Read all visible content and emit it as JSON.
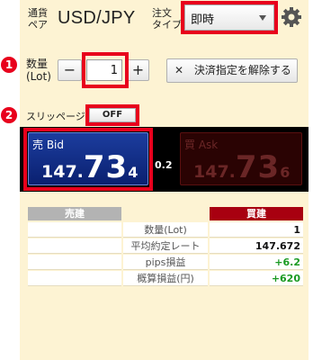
{
  "header": {
    "pair_label": "通貨\nペア",
    "pair_label_line1": "通貨",
    "pair_label_line2": "ペア",
    "pair_value": "USD/JPY",
    "order_type_line1": "注文",
    "order_type_line2": "タイプ",
    "order_type_selected": "即時"
  },
  "quantity": {
    "marker": "1",
    "label_line1": "数量",
    "label_line2": "(Lot)",
    "minus_label": "−",
    "value": "1",
    "plus_label": "+",
    "cancel_label": "決済指定を解除する"
  },
  "slippage": {
    "marker": "2",
    "label": "スリッページ",
    "toggle_label": "OFF"
  },
  "prices": {
    "bid_label": "売 Bid",
    "bid_p1": "147.",
    "bid_p2": "73",
    "bid_p3": "4",
    "spread": "0.2",
    "ask_label": "買 Ask",
    "ask_p1": "147.",
    "ask_p2": "73",
    "ask_p3": "6"
  },
  "positions": {
    "sell_header": "売建",
    "buy_header": "買建",
    "rows": [
      {
        "label": "数量(Lot)",
        "buy": "1"
      },
      {
        "label": "平均約定レート",
        "buy": "147.672"
      },
      {
        "label": "pips損益",
        "buy": "+6.2"
      },
      {
        "label": "概算損益(円)",
        "buy": "+620"
      }
    ]
  },
  "colors": {
    "highlight": "#e8001c",
    "bid_bg": "#1c3d9e",
    "ask_bg": "#2a0303",
    "buy_header": "#a80010",
    "sell_header": "#b3b3b3",
    "profit": "#1a9a22",
    "panel_bg": "#fdf3d3"
  },
  "icons": {
    "settings": "gear-icon",
    "clear": "x-icon",
    "dropdown": "triangle-down-icon"
  }
}
